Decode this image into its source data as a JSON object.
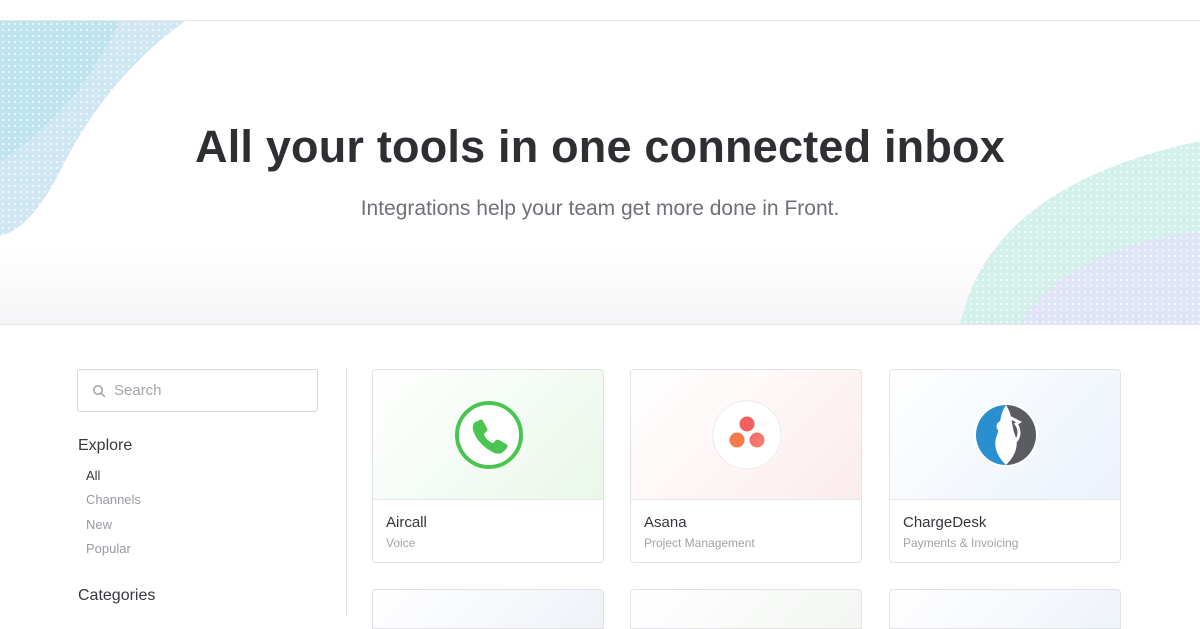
{
  "hero": {
    "title": "All your tools in one connected inbox",
    "subtitle": "Integrations help your team get more done in Front."
  },
  "sidebar": {
    "search_placeholder": "Search",
    "explore_heading": "Explore",
    "explore_items": [
      {
        "label": "All",
        "active": true
      },
      {
        "label": "Channels",
        "active": false
      },
      {
        "label": "New",
        "active": false
      },
      {
        "label": "Popular",
        "active": false
      }
    ],
    "categories_heading": "Categories"
  },
  "integrations": [
    {
      "name": "Aircall",
      "category": "Voice",
      "icon": "phone-icon",
      "tint": "#eef8ee"
    },
    {
      "name": "Asana",
      "category": "Project Management",
      "icon": "asana-dots-icon",
      "tint": "#fcefef"
    },
    {
      "name": "ChargeDesk",
      "category": "Payments & Invoicing",
      "icon": "chargedesk-logo-icon",
      "tint": "#eef4fb"
    }
  ],
  "colors": {
    "aircall_green": "#4bc551",
    "asana_coral": "#f06a6a",
    "chargedesk_blue": "#2a8fd0"
  }
}
